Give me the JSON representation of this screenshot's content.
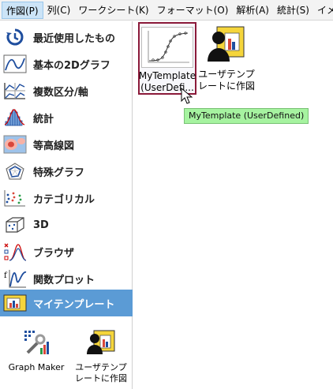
{
  "menu": {
    "items": [
      "作図(P)",
      "列(C)",
      "ワークシート(K)",
      "フォーマット(O)",
      "解析(A)",
      "統計(S)",
      "イメー"
    ]
  },
  "sidebar": {
    "items": [
      {
        "label": "最近使用したもの",
        "icon": "recent-icon"
      },
      {
        "label": "基本の2Dグラフ",
        "icon": "line-graph-icon"
      },
      {
        "label": "複数区分/軸",
        "icon": "multi-panel-icon"
      },
      {
        "label": "統計",
        "icon": "histogram-icon"
      },
      {
        "label": "等高線図",
        "icon": "contour-icon"
      },
      {
        "label": "特殊グラフ",
        "icon": "radar-icon"
      },
      {
        "label": "カテゴリカル",
        "icon": "categorical-icon"
      },
      {
        "label": "3D",
        "icon": "cube-icon"
      },
      {
        "label": "ブラウザ",
        "icon": "browser-icon"
      },
      {
        "label": "関数プロット",
        "icon": "function-plot-icon"
      },
      {
        "label": "マイテンプレート",
        "icon": "my-template-icon",
        "selected": true
      }
    ],
    "bottom_tiles": [
      {
        "label": "Graph Maker",
        "icon": "graph-maker-icon"
      },
      {
        "label_line1": "ユーザテンプ",
        "label_line2": "レートに作図",
        "icon": "user-template-icon"
      }
    ]
  },
  "main": {
    "tiles": [
      {
        "label_line1": "MyTemplate",
        "label_line2": "(UserDefi...",
        "selected": true
      },
      {
        "label_line1": "ユーザテンプ",
        "label_line2": "レートに作図"
      }
    ],
    "tooltip": "MyTemplate (UserDefined)"
  },
  "colors": {
    "selection": "#5b9bd5",
    "tile_border": "#8b1a3a",
    "tooltip_bg": "#a6f3a0"
  }
}
